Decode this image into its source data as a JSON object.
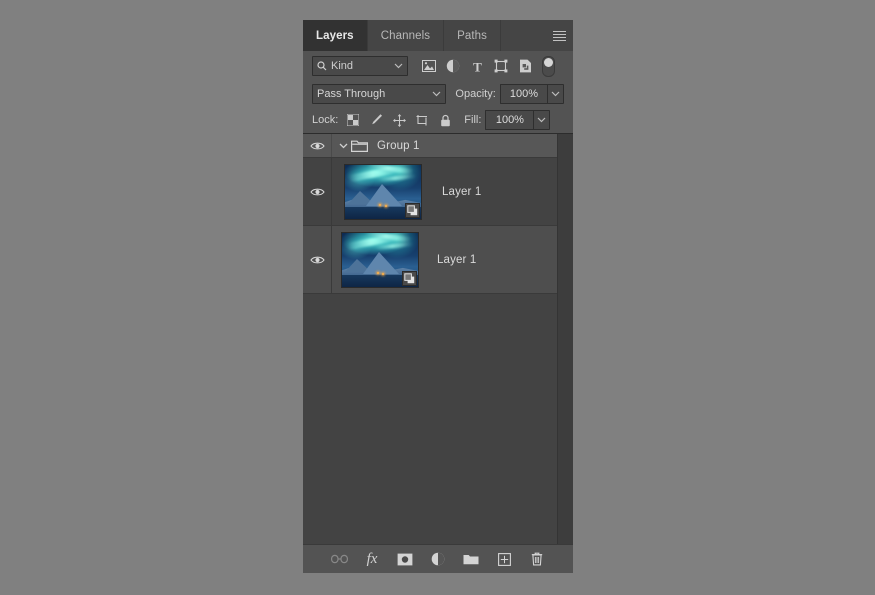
{
  "panel": {
    "tabs": [
      {
        "label": "Layers",
        "active": true
      },
      {
        "label": "Channels",
        "active": false
      },
      {
        "label": "Paths",
        "active": false
      }
    ],
    "menu_icon": "hamburger-menu-icon"
  },
  "filter": {
    "kind_label": "Kind",
    "search_icon": "search-icon",
    "chevron_icon": "chevron-down-icon",
    "type_filters": [
      {
        "name": "pixel-layer-filter-icon"
      },
      {
        "name": "adjustment-layer-filter-icon"
      },
      {
        "name": "type-layer-filter-icon"
      },
      {
        "name": "shape-layer-filter-icon"
      },
      {
        "name": "smart-object-filter-icon"
      }
    ],
    "toggle": {
      "name": "filter-enable-toggle",
      "state": "off"
    }
  },
  "options": {
    "blend_mode": "Pass Through",
    "opacity_label": "Opacity:",
    "opacity_value": "100%",
    "lock_label": "Lock:",
    "lock_icons": [
      "lock-transparent-pixels-icon",
      "lock-image-pixels-icon",
      "lock-position-icon",
      "lock-artboard-nesting-icon",
      "lock-all-icon"
    ],
    "fill_label": "Fill:",
    "fill_value": "100%"
  },
  "layers": [
    {
      "name": "Group 1",
      "type": "group",
      "visible": true,
      "selected": false,
      "expanded": true,
      "indent": 0
    },
    {
      "name": "Layer 1",
      "type": "smart-object",
      "visible": true,
      "selected": false,
      "indent": 1,
      "badge": "smart-object-badge"
    },
    {
      "name": "Layer 1",
      "type": "smart-object",
      "visible": true,
      "selected": true,
      "indent": 0,
      "badge": "smart-object-badge"
    }
  ],
  "bottom_toolbar": [
    {
      "name": "link-layers-button",
      "label": "Link layers",
      "enabled": false
    },
    {
      "name": "layer-style-button",
      "label": "fx",
      "enabled": true
    },
    {
      "name": "add-layer-mask-button",
      "label": "Add layer mask",
      "enabled": true
    },
    {
      "name": "new-adjustment-layer-button",
      "label": "New fill or adjustment layer",
      "enabled": true
    },
    {
      "name": "new-group-button",
      "label": "Create a new group",
      "enabled": true
    },
    {
      "name": "new-layer-button",
      "label": "Create a new layer",
      "enabled": true
    },
    {
      "name": "delete-layer-button",
      "label": "Delete layer",
      "enabled": true
    }
  ],
  "colors": {
    "panel_bg": "#535353",
    "list_bg": "#434343",
    "group_row_bg": "#575757",
    "selected_row_bg": "#4e4e4e",
    "active_tab_bg": "#323232",
    "tab_bar_bg": "#454545",
    "text": "#d4d4d4",
    "page_bg": "#808080"
  }
}
